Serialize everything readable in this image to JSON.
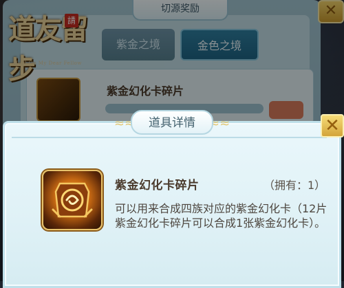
{
  "game": {
    "logo_text": "道友留步",
    "logo_seal": "請",
    "logo_subtitle": "Hold On My Dear Fellow"
  },
  "background_panel": {
    "title": "切源奖励",
    "tabs": [
      {
        "label": "紫金之境",
        "active": false
      },
      {
        "label": "金色之境",
        "active": true
      }
    ],
    "reward_item_name": "紫金幻化卡碎片"
  },
  "dialog": {
    "title": "道具详情",
    "close_glyph": "✕",
    "item": {
      "name": "紫金幻化卡碎片",
      "owned": "（拥有：1）",
      "description": "可以用来合成四族对应的紫金幻化卡（12片紫金幻化卡碎片可以合成1张紫金幻化卡）。",
      "icon": "card-fragment-icon"
    }
  },
  "colors": {
    "panel_bg": "#dff1f6",
    "panel_border": "#bfe0ea",
    "gold_accent": "#e2c774",
    "title_text": "#43616e",
    "body_text": "#4e4740"
  }
}
